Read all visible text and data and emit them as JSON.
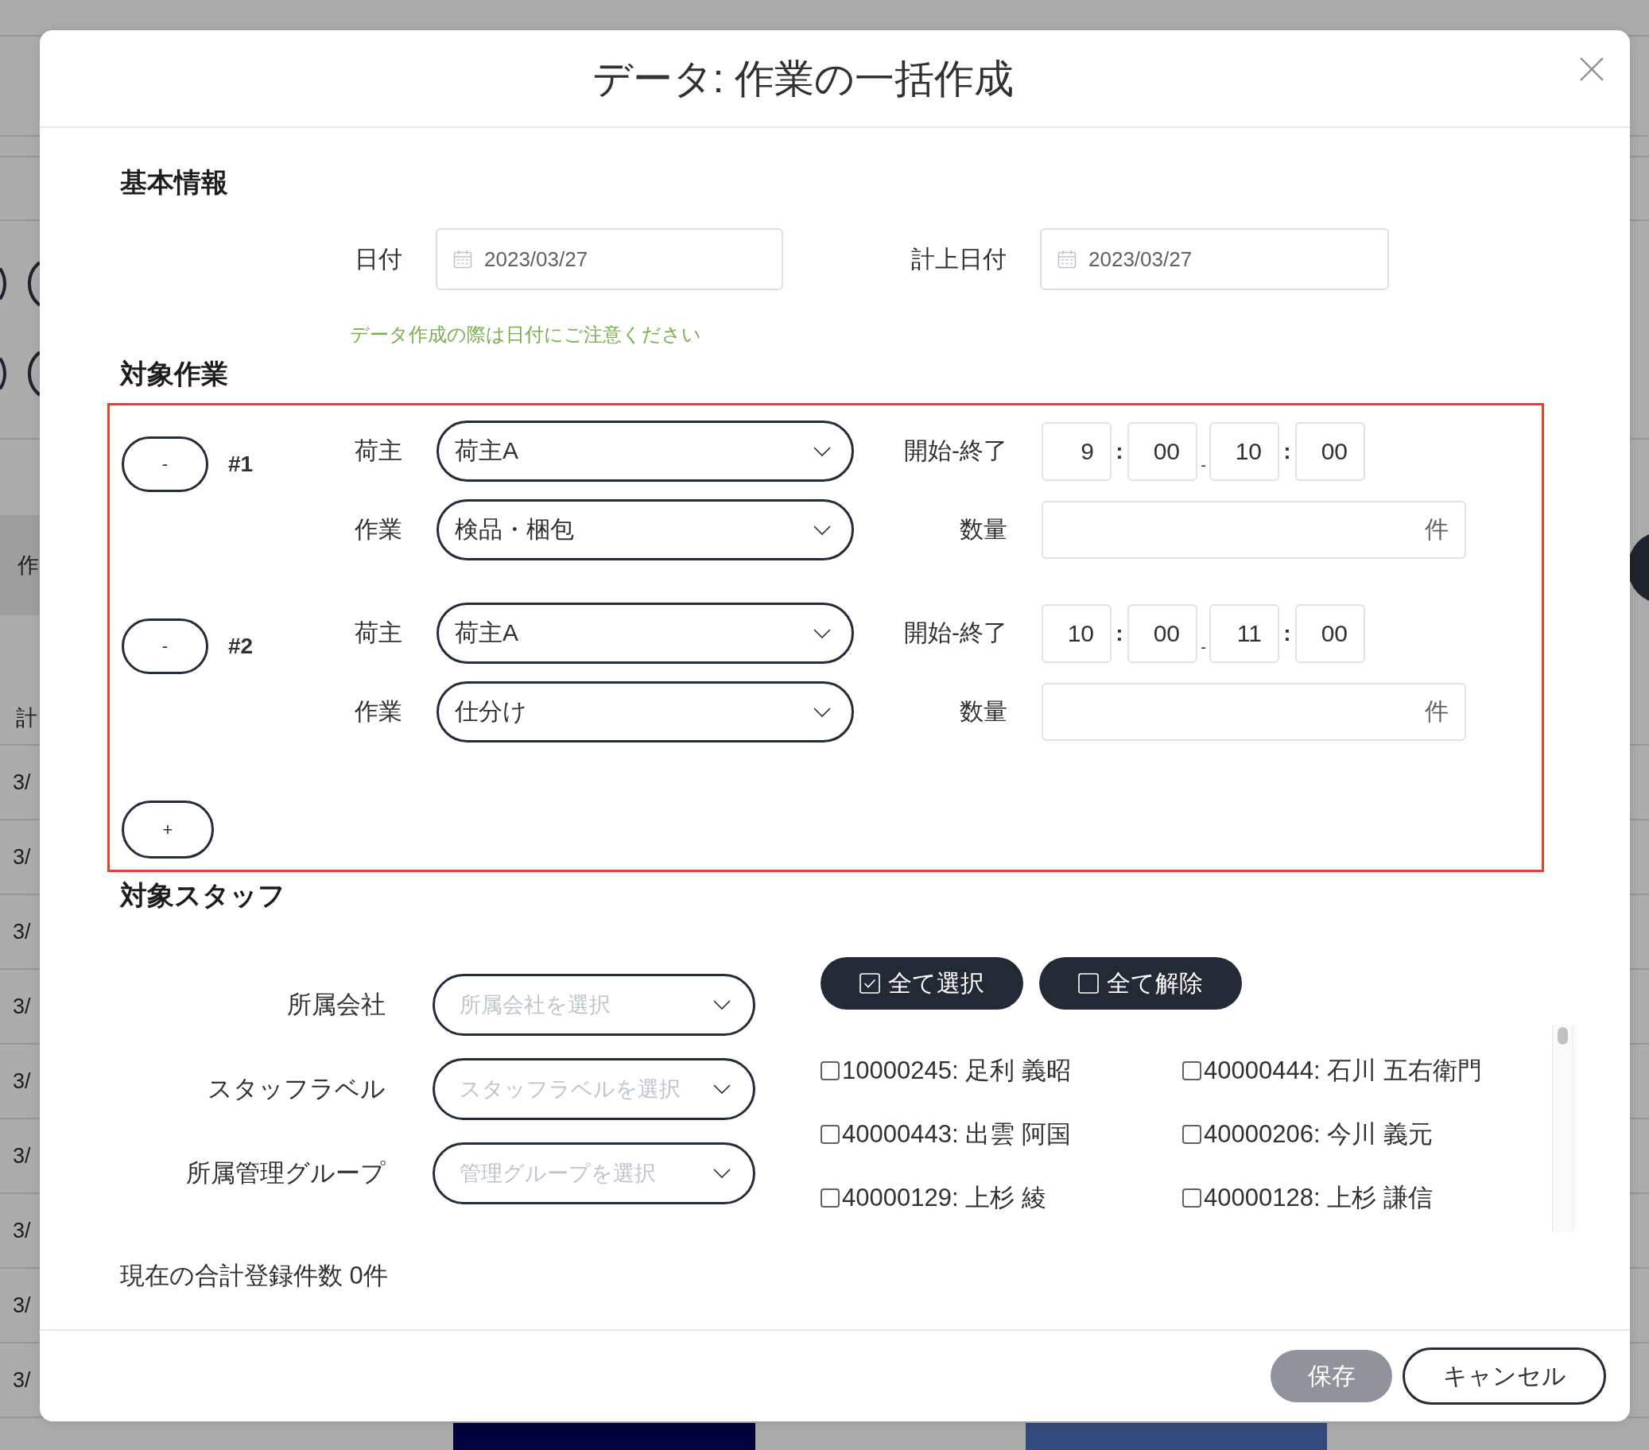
{
  "background": {
    "header_cell": "作",
    "label_cell": "計",
    "date_cells": [
      "3/",
      "3/",
      "3/",
      "3/",
      "3/",
      "3/",
      "3/",
      "3/",
      "3/"
    ]
  },
  "dialog": {
    "title": "データ: 作業の一括作成",
    "basic_info": {
      "heading": "基本情報",
      "fields": [
        {
          "label": "日付",
          "value": "2023/03/27"
        },
        {
          "label": "計上日付",
          "value": "2023/03/27"
        }
      ],
      "note": "データ作成の際は日付にご注意ください"
    },
    "tasks": {
      "heading": "対象作業",
      "highlighted": true,
      "items": [
        {
          "remove_button": "-",
          "number": "#1",
          "shipper_label": "荷主",
          "shipper": "荷主A",
          "task_label": "作業",
          "task": "検品・梱包",
          "time_label": "開始-終了",
          "time": [
            "9",
            "00",
            "10",
            "00"
          ],
          "separators": [
            ":",
            "-",
            ":"
          ],
          "quantity_label": "数量",
          "quantity_unit": "件"
        },
        {
          "remove_button": "-",
          "number": "#2",
          "shipper_label": "荷主",
          "shipper": "荷主A",
          "task_label": "作業",
          "task": "仕分け",
          "time_label": "開始-終了",
          "time": [
            "10",
            "00",
            "11",
            "00"
          ],
          "separators": [
            ":",
            "-",
            ":"
          ],
          "quantity_label": "数量",
          "quantity_unit": "件"
        }
      ],
      "add_button": "+"
    },
    "staff": {
      "heading": "対象スタッフ",
      "filters": [
        {
          "label": "所属会社",
          "placeholder": "所属会社を選択"
        },
        {
          "label": "スタッフラベル",
          "placeholder": "スタッフラベルを選択"
        },
        {
          "label": "所属管理グループ",
          "placeholder": "管理グループを選択"
        }
      ],
      "select_all": "全て選択",
      "deselect_all": "全て解除",
      "members": [
        {
          "name": "10000245: 足利 義昭",
          "checked": false
        },
        {
          "name": "40000444: 石川 五右衛門",
          "checked": false
        },
        {
          "name": "40000443: 出雲 阿国",
          "checked": false
        },
        {
          "name": "40000206: 今川 義元",
          "checked": false
        },
        {
          "name": "40000129: 上杉 綾",
          "checked": false
        },
        {
          "name": "40000128: 上杉 謙信",
          "checked": false
        }
      ]
    },
    "total": "現在の合計登録件数 0件",
    "buttons": [
      {
        "label": "保存",
        "kind": "save",
        "disabled": true
      },
      {
        "label": "キャンセル",
        "kind": "cancel"
      }
    ]
  }
}
